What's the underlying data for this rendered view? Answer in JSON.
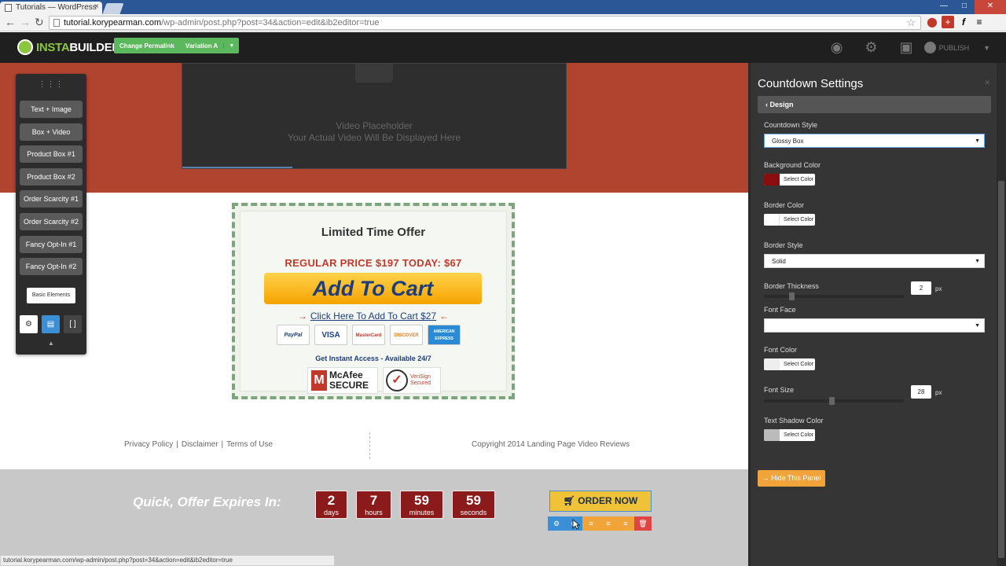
{
  "browser": {
    "tab_title": "Tutorials — WordPress",
    "url_host": "tutorial.korypearman.com",
    "url_path": "/wp-admin/post.php?post=34&action=edit&ib2editor=true",
    "status_url": "tutorial.korypearman.com/wp-admin/post.php?post=34&action=edit&ib2editor=true"
  },
  "toolbar": {
    "logo_a": "INSTA",
    "logo_b": "BUILDER 2.0",
    "permalink_label": "Change Permalink",
    "variation_label": "Variation A",
    "publish_label": "PUBLISH"
  },
  "palette": {
    "items": [
      "Text + Image",
      "Box + Video",
      "Product Box #1",
      "Product Box #2",
      "Order Scarcity #1",
      "Order Scarcity #2",
      "Fancy Opt-In #1",
      "Fancy Opt-In #2"
    ],
    "basic_label": "Basic Elements"
  },
  "video": {
    "line1": "Video Placeholder",
    "line2": "Your Actual Video Will Be Displayed Here"
  },
  "offer": {
    "title": "Limited Time Offer",
    "price": "REGULAR PRICE $197   TODAY: $67",
    "cart_button": "Add To Cart",
    "cart_link": "Click Here To Add To Cart $27",
    "cards": [
      "PayPal",
      "VISA",
      "MasterCard",
      "DISCOVER",
      "AMERICAN EXPRESS"
    ],
    "instant": "Get Instant Access - Available 24/7",
    "mcafee_line1": "McAfee",
    "mcafee_line2": "SECURE",
    "verisign_line1": "VeriSign",
    "verisign_line2": "Secured"
  },
  "footer": {
    "privacy": "Privacy Policy",
    "disclaimer": "Disclaimer",
    "terms": "Terms of Use",
    "copyright": "Copyright 2014 Landing Page Video Reviews"
  },
  "sticky": {
    "quick_text": "Quick, Offer Expires In:",
    "countdown": [
      {
        "num": "2",
        "unit": "days"
      },
      {
        "num": "7",
        "unit": "hours"
      },
      {
        "num": "59",
        "unit": "minutes"
      },
      {
        "num": "59",
        "unit": "seconds"
      }
    ],
    "order_label": "ORDER NOW"
  },
  "panel": {
    "title": "Countdown Settings",
    "back_label": "Design",
    "countdown_style_label": "Countdown Style",
    "countdown_style_value": "Glossy Box",
    "bg_color_label": "Background Color",
    "border_color_label": "Border Color",
    "border_style_label": "Border Style",
    "border_style_value": "Solid",
    "border_thickness_label": "Border Thickness",
    "border_thickness_value": "2",
    "font_face_label": "Font Face",
    "font_face_value": "",
    "font_color_label": "Font Color",
    "font_size_label": "Font Size",
    "font_size_value": "28",
    "text_shadow_label": "Text Shadow Color",
    "select_color": "Select Color",
    "px_unit": "px",
    "hide_label": "→ Hide This Panel",
    "colors": {
      "background": "#8b0d0d",
      "border": "#ffffff",
      "font": "#eeeeee",
      "text_shadow": "#bbbbbb"
    }
  }
}
